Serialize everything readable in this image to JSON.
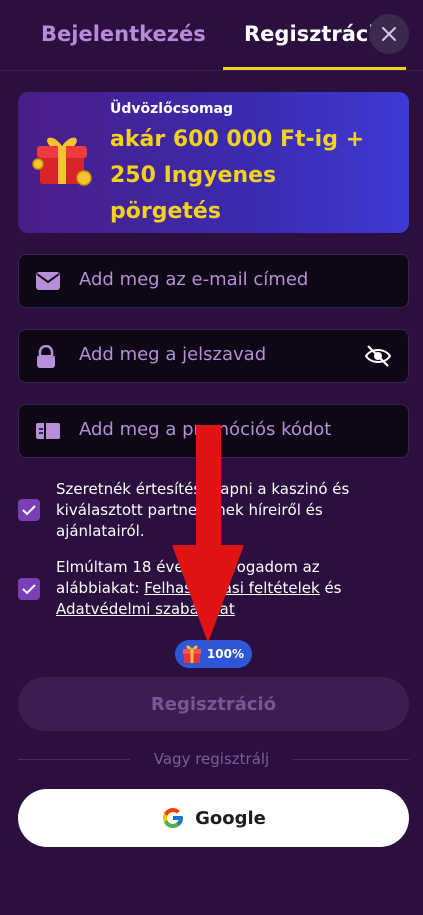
{
  "tabs": {
    "login": "Bejelentkezés",
    "register": "Regisztráció"
  },
  "promo": {
    "small_title": "Üdvözlőcsomag",
    "main_line1": "akár 600 000 Ft-ig +",
    "main_line2": "250 Ingyenes",
    "main_line3": "pörgetés"
  },
  "fields": {
    "email_placeholder": "Add meg az e-mail címed",
    "password_placeholder": "Add meg a jelszavad",
    "promo_code_placeholder": "Add meg a promóciós kódot"
  },
  "checkboxes": {
    "newsletter": "Szeretnék értesítést kapni a kaszinó és kiválasztott partnereinek híreiről és ajánlatairól.",
    "terms_prefix": "Elmúltam 18 éves és elfogadom az alábbiakat: ",
    "terms_link": "Felhasználási feltételek",
    "terms_mid": " és ",
    "privacy_link": "Adatvédelmi szabályzat"
  },
  "progress_badge": "100%",
  "register_button": "Regisztráció",
  "or_text": "Vagy regisztrálj",
  "google_button": "Google",
  "colors": {
    "background": "#2a0f3f",
    "accent_yellow": "#f2d21e",
    "checkbox": "#7a3fb4",
    "arrow_red": "#e01414"
  }
}
